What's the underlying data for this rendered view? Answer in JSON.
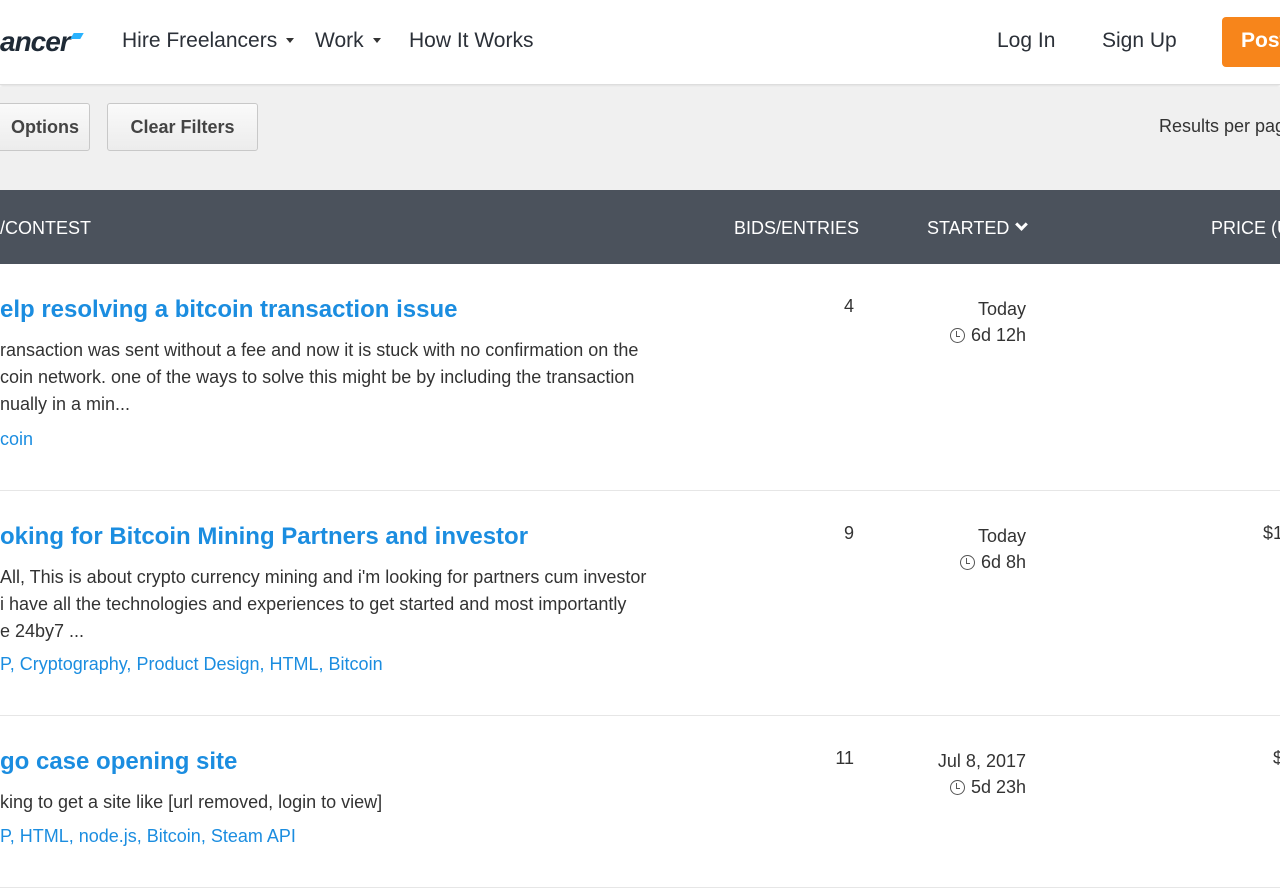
{
  "header": {
    "logo": "ancer",
    "nav": [
      {
        "label": "Hire Freelancers",
        "dropdown": true
      },
      {
        "label": "Work",
        "dropdown": true
      },
      {
        "label": "How It Works",
        "dropdown": false
      }
    ],
    "login": "Log In",
    "signup": "Sign Up",
    "post": "Post",
    "accent": "#f7851b"
  },
  "toolbar": {
    "options": "Options",
    "clear": "Clear Filters",
    "results_per_page": "Results per pag"
  },
  "table": {
    "headers": {
      "title": "/CONTEST",
      "bids": "BIDS/ENTRIES",
      "started": "STARTED",
      "price": "PRICE (U"
    },
    "rows": [
      {
        "title": "elp resolving a bitcoin transaction issue",
        "desc": [
          "ransaction was sent without a fee and now it is stuck with no confirmation on the",
          "coin network. one of the ways to solve this might be by including the transaction",
          "nually in a min..."
        ],
        "skills": [
          "coin"
        ],
        "bids": "4",
        "started": "Today",
        "remaining": "6d 12h",
        "price": ""
      },
      {
        "title": "oking for Bitcoin Mining Partners and investor",
        "desc": [
          "All, This is about crypto currency mining and i'm looking for partners cum investor",
          "i have all the technologies and experiences to get started and most importantly",
          "e 24by7 ..."
        ],
        "skills": [
          "P",
          "Cryptography",
          "Product Design",
          "HTML",
          "Bitcoin"
        ],
        "bids": "9",
        "started": "Today",
        "remaining": "6d 8h",
        "price": "$1"
      },
      {
        "title": "go case opening site",
        "desc": [
          "king to get a site like [url removed, login to view]"
        ],
        "skills": [
          "P",
          "HTML",
          "node.js",
          "Bitcoin",
          "Steam API"
        ],
        "bids": "11",
        "started": "Jul 8, 2017",
        "remaining": "5d 23h",
        "price": "$"
      }
    ]
  }
}
